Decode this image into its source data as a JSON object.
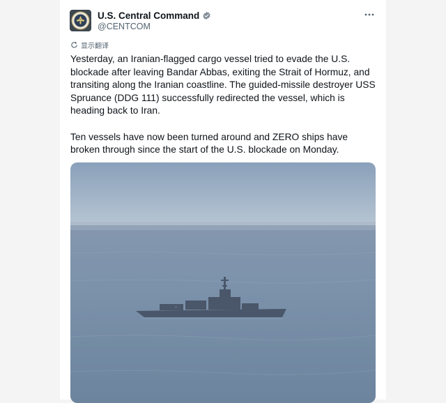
{
  "tweet": {
    "author_name": "U.S. Central Command",
    "handle": "@CENTCOM",
    "translate_label": "显示翻译",
    "text": "Yesterday, an Iranian-flagged cargo vessel tried to evade the U.S. blockade after leaving Bandar Abbas, exiting the Strait of Hormuz, and transiting along the Iranian coastline. The guided-missile destroyer USS Spruance (DDG 111) successfully redirected the vessel, which is heading back to Iran.\n\nTen vessels have now been turned around and ZERO ships have broken through since the start of the U.S. blockade on Monday.",
    "more_icon": "ellipsis-icon",
    "verified_icon": "verified-badge-icon",
    "translate_icon": "translate-icon"
  },
  "colors": {
    "verified": "#7f8a94",
    "text": "#0f1419",
    "secondary": "#536471",
    "avatar_bg": "#3d4750"
  }
}
